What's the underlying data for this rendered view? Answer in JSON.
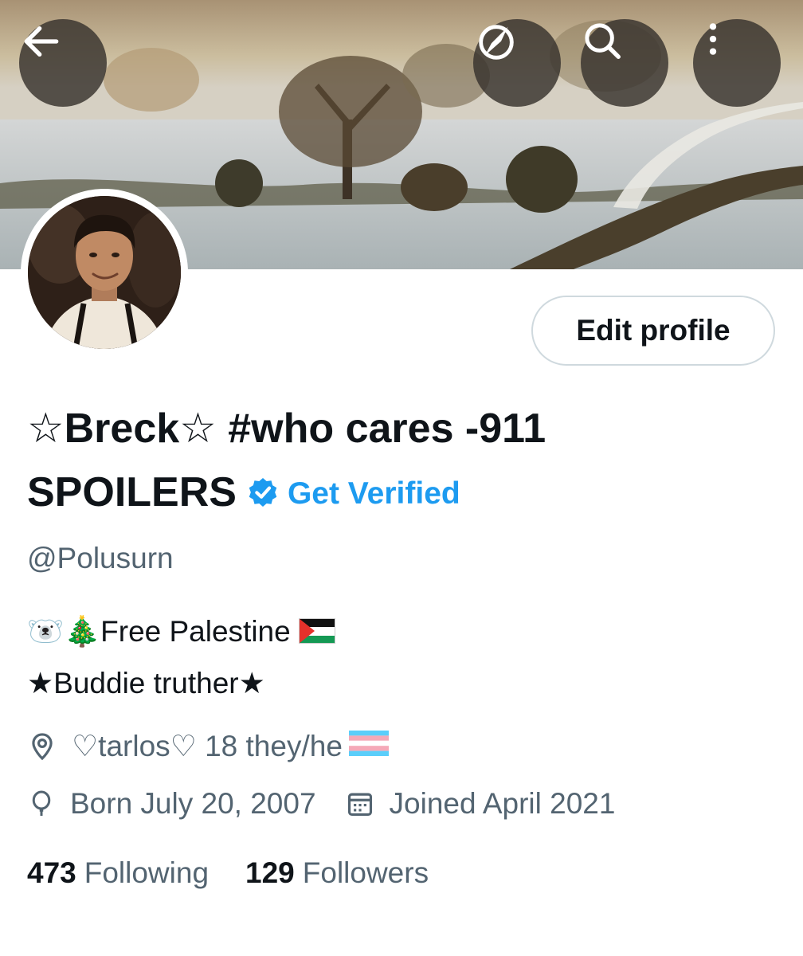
{
  "header": {
    "back_icon": "arrow-left-icon",
    "discover_icon": "compass-icon",
    "search_icon": "search-icon",
    "more_icon": "more-vertical-icon"
  },
  "profile": {
    "edit_label": "Edit profile",
    "name_line1": "☆Breck☆ #who cares -911",
    "name_line2": "SPOILERS",
    "get_verified": "Get Verified",
    "handle": "@Polusurn",
    "bio_line1_prefix": "🐻‍❄️🎄",
    "bio_line1_text": "Free Palestine",
    "bio_line2": "★Buddie truther★",
    "location": "♡tarlos♡ 18 they/he",
    "birth": "Born July 20, 2007",
    "joined": "Joined April 2021",
    "following_count": "473",
    "following_label": "Following",
    "followers_count": "129",
    "followers_label": "Followers"
  },
  "colors": {
    "accent": "#1d9bf0",
    "text_primary": "#0f1419",
    "text_secondary": "#536471"
  }
}
